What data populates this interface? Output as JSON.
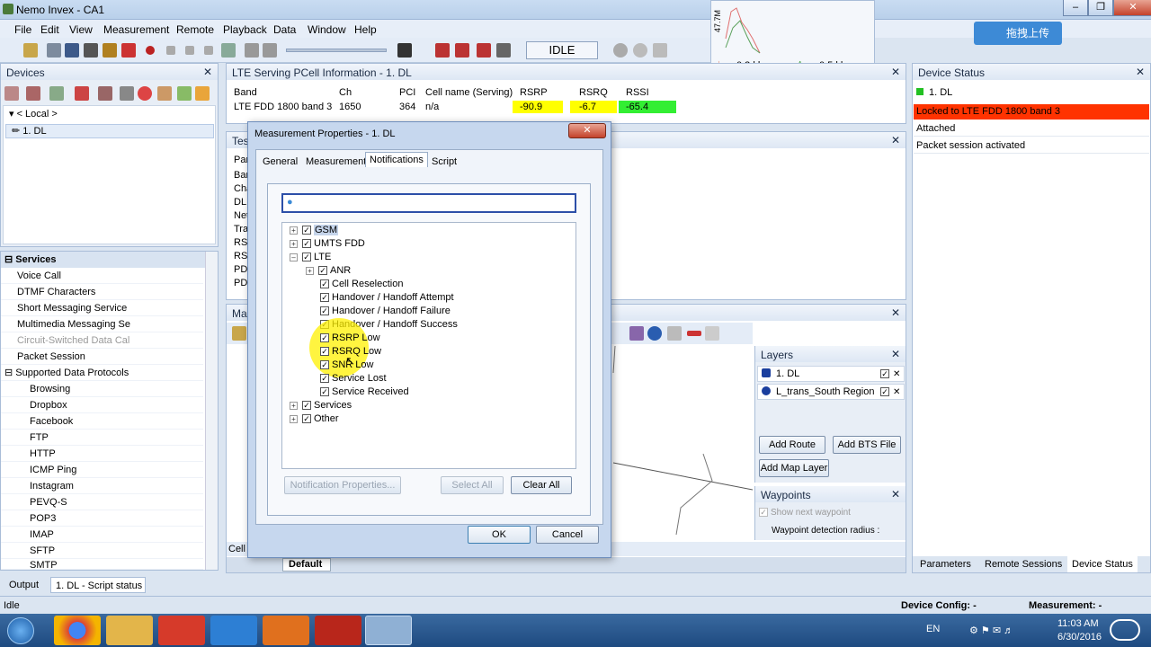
{
  "window": {
    "title": "Nemo Invex - CA1"
  },
  "menu": [
    "File",
    "Edit",
    "View",
    "Measurement",
    "Remote",
    "Playback",
    "Data",
    "Window",
    "Help"
  ],
  "toolbar": {
    "idle_label": "IDLE"
  },
  "throughput": {
    "yaxis": "47.7M",
    "down": "0.3 kbps",
    "up": "0.5 kbps"
  },
  "upload_button": "拖拽上传",
  "devices": {
    "title": "Devices",
    "local": "< Local >",
    "device": "1. DL"
  },
  "services": {
    "title": "Services",
    "items": [
      "Voice Call",
      "DTMF Characters",
      "Short Messaging Service",
      "Multimedia Messaging Se",
      "Circuit-Switched Data Cal",
      "Packet Session"
    ],
    "protocols_title": "Supported Data Protocols",
    "protocols": [
      "Browsing",
      "Dropbox",
      "Facebook",
      "FTP",
      "HTTP",
      "ICMP Ping",
      "Instagram",
      "PEVQ-S",
      "POP3",
      "IMAP",
      "SFTP",
      "SMTP"
    ]
  },
  "pcell": {
    "title": "LTE Serving PCell Information - 1. DL",
    "headers": [
      "Band",
      "Ch",
      "PCI",
      "Cell name (Serving)",
      "RSRP",
      "RSRQ",
      "RSSI"
    ],
    "row": [
      "LTE FDD 1800 band 3",
      "1650",
      "364",
      "n/a",
      "-90.9",
      "-6.7",
      "-65.4"
    ],
    "colors": {
      "rsrp": "#ffff00",
      "rsrq": "#ffff00",
      "rssi": "#33ee33"
    }
  },
  "test_panel": {
    "title_frag": "Test",
    "rows": [
      "Par",
      "Ban",
      "Cha",
      "DL",
      "Net",
      "Tra",
      "RS",
      "RS",
      "PD",
      "PD"
    ]
  },
  "map_panel": {
    "title_frag": "Map",
    "bottom_frag": "Cell",
    "default_tab": "Default"
  },
  "layers": {
    "title": "Layers",
    "items": [
      "1. DL",
      "L_trans_South Region"
    ],
    "add_route": "Add Route",
    "add_bts": "Add BTS File",
    "add_map": "Add Map Layer"
  },
  "waypoints": {
    "title": "Waypoints",
    "show_next": "Show next waypoint",
    "radius": "Waypoint detection radius :"
  },
  "device_status": {
    "title": "Device Status",
    "device": "1. DL",
    "lines": [
      "Locked to LTE FDD 1800 band 3",
      "Attached",
      "Packet session activated"
    ],
    "locked_color": "#ff3300",
    "tabs": [
      "Parameters",
      "Remote Sessions",
      "Device Status"
    ]
  },
  "dialog": {
    "title": "Measurement Properties - 1. DL",
    "tabs": [
      "General",
      "Measurement",
      "Notifications",
      "Script"
    ],
    "tree": [
      {
        "label": "GSM",
        "level": 0,
        "exp": "+"
      },
      {
        "label": "UMTS FDD",
        "level": 0,
        "exp": "+"
      },
      {
        "label": "LTE",
        "level": 0,
        "exp": "-"
      },
      {
        "label": "ANR",
        "level": 1,
        "exp": "+"
      },
      {
        "label": "Cell Reselection",
        "level": 1
      },
      {
        "label": "Handover / Handoff Attempt",
        "level": 1
      },
      {
        "label": "Handover / Handoff Failure",
        "level": 1
      },
      {
        "label": "Handover / Handoff Success",
        "level": 1
      },
      {
        "label": "RSRP Low",
        "level": 1
      },
      {
        "label": "RSRQ Low",
        "level": 1
      },
      {
        "label": "SNR Low",
        "level": 1
      },
      {
        "label": "Service Lost",
        "level": 1
      },
      {
        "label": "Service Received",
        "level": 1
      },
      {
        "label": "Services",
        "level": 0,
        "exp": "+"
      },
      {
        "label": "Other",
        "level": 0,
        "exp": "+"
      }
    ],
    "notif_props": "Notification Properties...",
    "select_all": "Select All",
    "clear_all": "Clear All",
    "ok": "OK",
    "cancel": "Cancel"
  },
  "bottom_tabs": [
    "Output",
    "1. DL - Script status"
  ],
  "statusbar": {
    "left": "Idle",
    "config": "Device Config: -",
    "measurement": "Measurement: -"
  },
  "tray": {
    "lang": "EN",
    "time": "11:03 AM",
    "date": "6/30/2016"
  }
}
